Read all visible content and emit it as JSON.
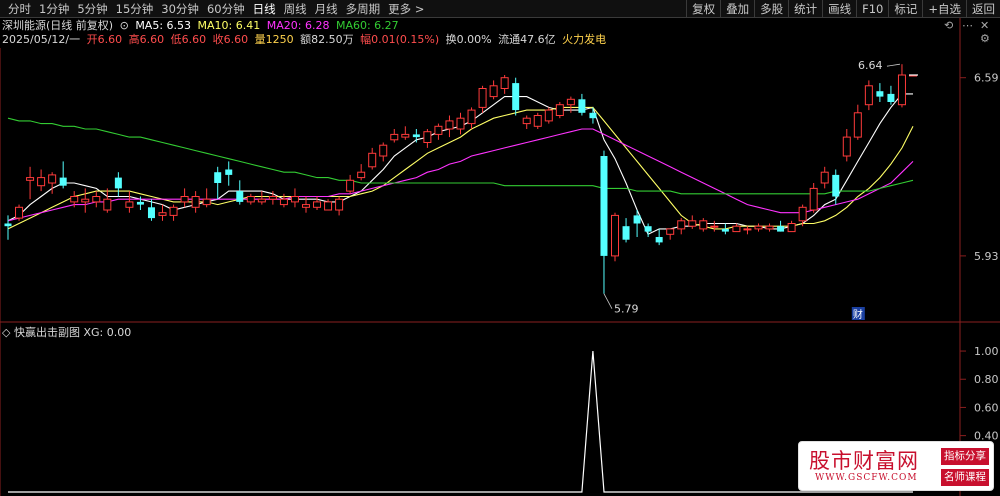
{
  "toolbar": {
    "periods": [
      "分时",
      "1分钟",
      "5分钟",
      "15分钟",
      "30分钟",
      "60分钟",
      "日线",
      "周线",
      "月线",
      "多周期",
      "更多 >"
    ],
    "active_period": "日线",
    "actions": [
      "复权",
      "叠加",
      "多股",
      "统计",
      "画线",
      "F10",
      "标记",
      "+自选",
      "返回"
    ]
  },
  "info": {
    "stock": "深圳能源(日线 前复权)",
    "ma5": "MA5: 6.53",
    "ma10": "MA10: 6.41",
    "ma20": "MA20: 6.28",
    "ma60": "MA60: 6.27",
    "date": "2025/05/12/一",
    "open": "开6.60",
    "high": "高6.60",
    "low": "低6.60",
    "close": "收6.60",
    "volume": "量1250",
    "amount": "额82.50万",
    "change": "幅0.01(0.15%)",
    "turnover": "换0.00%",
    "float": "流通47.6亿",
    "concept": "火力发电"
  },
  "sub_chart": {
    "title": "快赢出击副图",
    "xg": "XG: 0.00"
  },
  "watermark": {
    "main": "股市财富网",
    "sub": "WWW.GSCFW.COM",
    "tag1": "指标分享",
    "tag2": "名师课程"
  },
  "colors": {
    "up": "#ff3b3b",
    "down": "#54ffff",
    "ma5": "#ffffff",
    "ma10": "#ffff66",
    "ma20": "#ff33ff",
    "ma60": "#33cc33"
  },
  "chart_data": [
    {
      "type": "candlestick",
      "ylim": [
        5.7,
        6.7
      ],
      "y_ticks": [
        "6.59",
        "5.93"
      ],
      "annotations": {
        "max_label": "6.64",
        "min_label": "5.79",
        "finance_marker": "财"
      },
      "candles": [
        [
          6.05,
          6.08,
          5.99,
          6.04
        ],
        [
          6.07,
          6.12,
          6.06,
          6.11
        ],
        [
          6.21,
          6.26,
          6.14,
          6.22
        ],
        [
          6.19,
          6.25,
          6.17,
          6.22
        ],
        [
          6.2,
          6.24,
          6.16,
          6.23
        ],
        [
          6.22,
          6.28,
          6.18,
          6.19
        ],
        [
          6.13,
          6.17,
          6.11,
          6.15
        ],
        [
          6.13,
          6.18,
          6.09,
          6.14
        ],
        [
          6.13,
          6.17,
          6.11,
          6.15
        ],
        [
          6.1,
          6.18,
          6.09,
          6.14
        ],
        [
          6.22,
          6.24,
          6.15,
          6.18
        ],
        [
          6.11,
          6.17,
          6.09,
          6.13
        ],
        [
          6.13,
          6.15,
          6.1,
          6.12
        ],
        [
          6.11,
          6.14,
          6.06,
          6.07
        ],
        [
          6.08,
          6.12,
          6.06,
          6.09
        ],
        [
          6.08,
          6.12,
          6.06,
          6.11
        ],
        [
          6.13,
          6.18,
          6.11,
          6.15
        ],
        [
          6.11,
          6.17,
          6.09,
          6.15
        ],
        [
          6.12,
          6.18,
          6.11,
          6.14
        ],
        [
          6.24,
          6.26,
          6.14,
          6.2
        ],
        [
          6.25,
          6.28,
          6.19,
          6.23
        ],
        [
          6.17,
          6.21,
          6.12,
          6.13
        ],
        [
          6.13,
          6.16,
          6.12,
          6.15
        ],
        [
          6.13,
          6.17,
          6.12,
          6.14
        ],
        [
          6.14,
          6.17,
          6.12,
          6.15
        ],
        [
          6.12,
          6.16,
          6.11,
          6.14
        ],
        [
          6.13,
          6.18,
          6.11,
          6.15
        ],
        [
          6.11,
          6.15,
          6.09,
          6.12
        ],
        [
          6.11,
          6.15,
          6.1,
          6.13
        ],
        [
          6.1,
          6.14,
          6.1,
          6.13
        ],
        [
          6.1,
          6.15,
          6.08,
          6.14
        ],
        [
          6.17,
          6.23,
          6.16,
          6.21
        ],
        [
          6.22,
          6.27,
          6.21,
          6.24
        ],
        [
          6.26,
          6.33,
          6.25,
          6.31
        ],
        [
          6.3,
          6.35,
          6.28,
          6.34
        ],
        [
          6.36,
          6.4,
          6.35,
          6.38
        ],
        [
          6.37,
          6.41,
          6.36,
          6.38
        ],
        [
          6.38,
          6.4,
          6.35,
          6.37
        ],
        [
          6.35,
          6.4,
          6.33,
          6.39
        ],
        [
          6.38,
          6.42,
          6.36,
          6.41
        ],
        [
          6.4,
          6.45,
          6.37,
          6.43
        ],
        [
          6.4,
          6.46,
          6.38,
          6.44
        ],
        [
          6.42,
          6.48,
          6.4,
          6.47
        ],
        [
          6.48,
          6.56,
          6.46,
          6.55
        ],
        [
          6.52,
          6.58,
          6.51,
          6.56
        ],
        [
          6.55,
          6.6,
          6.53,
          6.59
        ],
        [
          6.57,
          6.59,
          6.45,
          6.47
        ],
        [
          6.42,
          6.45,
          6.4,
          6.44
        ],
        [
          6.41,
          6.46,
          6.4,
          6.45
        ],
        [
          6.43,
          6.48,
          6.42,
          6.47
        ],
        [
          6.45,
          6.5,
          6.44,
          6.49
        ],
        [
          6.49,
          6.52,
          6.46,
          6.51
        ],
        [
          6.51,
          6.53,
          6.45,
          6.46
        ],
        [
          6.46,
          6.48,
          6.42,
          6.44
        ],
        [
          6.3,
          6.32,
          5.79,
          5.93
        ],
        [
          5.93,
          6.09,
          5.91,
          6.08
        ],
        [
          6.04,
          6.07,
          5.98,
          5.99
        ],
        [
          6.08,
          6.1,
          6.0,
          6.05
        ],
        [
          6.04,
          6.05,
          6.0,
          6.02
        ],
        [
          6.0,
          6.03,
          5.97,
          5.98
        ],
        [
          6.01,
          6.03,
          5.99,
          6.03
        ],
        [
          6.03,
          6.07,
          6.01,
          6.06
        ],
        [
          6.04,
          6.08,
          6.03,
          6.06
        ],
        [
          6.03,
          6.07,
          6.02,
          6.06
        ],
        [
          6.04,
          6.06,
          6.02,
          6.04
        ],
        [
          6.03,
          6.05,
          6.01,
          6.02
        ],
        [
          6.02,
          6.05,
          6.02,
          6.04
        ],
        [
          6.03,
          6.04,
          6.01,
          6.03
        ],
        [
          6.03,
          6.05,
          6.02,
          6.04
        ],
        [
          6.03,
          6.05,
          6.02,
          6.04
        ],
        [
          6.04,
          6.06,
          6.02,
          6.02
        ],
        [
          6.02,
          6.06,
          6.02,
          6.05
        ],
        [
          6.06,
          6.12,
          6.04,
          6.11
        ],
        [
          6.1,
          6.2,
          6.09,
          6.18
        ],
        [
          6.2,
          6.26,
          6.18,
          6.24
        ],
        [
          6.23,
          6.25,
          6.12,
          6.15
        ],
        [
          6.3,
          6.4,
          6.28,
          6.37
        ],
        [
          6.37,
          6.49,
          6.36,
          6.46
        ],
        [
          6.49,
          6.58,
          6.47,
          6.56
        ],
        [
          6.54,
          6.57,
          6.5,
          6.52
        ],
        [
          6.53,
          6.56,
          6.49,
          6.5
        ],
        [
          6.49,
          6.64,
          6.48,
          6.6
        ],
        [
          6.6,
          6.6,
          6.6,
          6.6
        ]
      ],
      "series": [
        {
          "name": "MA5",
          "values": [
            6.06,
            6.08,
            6.12,
            6.15,
            6.18,
            6.2,
            6.2,
            6.19,
            6.18,
            6.15,
            6.15,
            6.15,
            6.14,
            6.13,
            6.12,
            6.1,
            6.11,
            6.12,
            6.13,
            6.14,
            6.17,
            6.17,
            6.17,
            6.17,
            6.16,
            6.14,
            6.14,
            6.14,
            6.14,
            6.13,
            6.13,
            6.15,
            6.17,
            6.21,
            6.25,
            6.3,
            6.33,
            6.36,
            6.37,
            6.39,
            6.4,
            6.41,
            6.43,
            6.46,
            6.49,
            6.52,
            6.52,
            6.52,
            6.5,
            6.48,
            6.47,
            6.47,
            6.47,
            6.48,
            6.36,
            6.29,
            6.2,
            6.1,
            6.01,
            6.03,
            6.03,
            6.04,
            6.04,
            6.05,
            6.05,
            6.05,
            6.05,
            6.04,
            6.04,
            6.03,
            6.03,
            6.04,
            6.05,
            6.08,
            6.12,
            6.14,
            6.21,
            6.28,
            6.35,
            6.42,
            6.48,
            6.53,
            6.53
          ]
        },
        {
          "name": "MA10",
          "values": [
            6.03,
            6.05,
            6.07,
            6.09,
            6.11,
            6.13,
            6.15,
            6.16,
            6.17,
            6.17,
            6.17,
            6.17,
            6.16,
            6.15,
            6.14,
            6.13,
            6.13,
            6.13,
            6.13,
            6.12,
            6.13,
            6.14,
            6.15,
            6.15,
            6.15,
            6.15,
            6.15,
            6.15,
            6.15,
            6.15,
            6.15,
            6.15,
            6.16,
            6.17,
            6.19,
            6.22,
            6.25,
            6.28,
            6.31,
            6.33,
            6.35,
            6.37,
            6.4,
            6.42,
            6.44,
            6.45,
            6.46,
            6.47,
            6.47,
            6.47,
            6.48,
            6.48,
            6.48,
            6.48,
            6.43,
            6.38,
            6.33,
            6.28,
            6.23,
            6.18,
            6.13,
            6.08,
            6.05,
            6.04,
            6.03,
            6.03,
            6.04,
            6.04,
            6.04,
            6.04,
            6.04,
            6.04,
            6.05,
            6.05,
            6.06,
            6.08,
            6.11,
            6.15,
            6.18,
            6.22,
            6.27,
            6.33,
            6.41
          ]
        },
        {
          "name": "MA20",
          "values": [
            6.06,
            6.07,
            6.08,
            6.09,
            6.1,
            6.11,
            6.12,
            6.12,
            6.13,
            6.13,
            6.14,
            6.14,
            6.14,
            6.14,
            6.14,
            6.14,
            6.14,
            6.14,
            6.14,
            6.14,
            6.14,
            6.14,
            6.14,
            6.14,
            6.14,
            6.14,
            6.15,
            6.15,
            6.15,
            6.15,
            6.16,
            6.16,
            6.17,
            6.18,
            6.19,
            6.2,
            6.21,
            6.22,
            6.24,
            6.25,
            6.27,
            6.28,
            6.3,
            6.31,
            6.32,
            6.33,
            6.34,
            6.35,
            6.36,
            6.37,
            6.38,
            6.39,
            6.4,
            6.4,
            6.38,
            6.36,
            6.34,
            6.32,
            6.3,
            6.28,
            6.26,
            6.24,
            6.22,
            6.2,
            6.18,
            6.16,
            6.14,
            6.12,
            6.11,
            6.1,
            6.09,
            6.09,
            6.09,
            6.1,
            6.11,
            6.12,
            6.13,
            6.14,
            6.16,
            6.18,
            6.2,
            6.24,
            6.28
          ]
        },
        {
          "name": "MA60",
          "values": [
            6.44,
            6.43,
            6.43,
            6.42,
            6.42,
            6.41,
            6.41,
            6.4,
            6.4,
            6.39,
            6.38,
            6.37,
            6.37,
            6.36,
            6.35,
            6.34,
            6.33,
            6.32,
            6.31,
            6.3,
            6.29,
            6.28,
            6.27,
            6.26,
            6.25,
            6.24,
            6.24,
            6.23,
            6.22,
            6.22,
            6.21,
            6.21,
            6.2,
            6.2,
            6.2,
            6.2,
            6.2,
            6.2,
            6.2,
            6.2,
            6.2,
            6.2,
            6.2,
            6.2,
            6.2,
            6.19,
            6.19,
            6.19,
            6.19,
            6.19,
            6.19,
            6.19,
            6.19,
            6.19,
            6.18,
            6.18,
            6.18,
            6.17,
            6.17,
            6.17,
            6.17,
            6.16,
            6.16,
            6.16,
            6.16,
            6.16,
            6.16,
            6.16,
            6.16,
            6.16,
            6.16,
            6.16,
            6.16,
            6.16,
            6.16,
            6.17,
            6.17,
            6.17,
            6.17,
            6.18,
            6.19,
            6.2,
            6.21
          ]
        }
      ]
    },
    {
      "type": "line",
      "name": "XG",
      "ylim": [
        0,
        1.05
      ],
      "y_ticks": [
        "1.00",
        "0.80",
        "0.60",
        "0.40"
      ],
      "spike_index": 54,
      "values_note": "",
      "series": [
        {
          "values": [
            0,
            0,
            0,
            0,
            0,
            0,
            0,
            0,
            0,
            0,
            0,
            0,
            0,
            0,
            0,
            0,
            0,
            0,
            0,
            0,
            0,
            0,
            0,
            0,
            0,
            0,
            0,
            0,
            0,
            0,
            0,
            0,
            0,
            0,
            0,
            0,
            0,
            0,
            0,
            0,
            0,
            0,
            0,
            0,
            0,
            0,
            0,
            0,
            0,
            0,
            0,
            0,
            0,
            1,
            0,
            0,
            0,
            0,
            0,
            0,
            0,
            0,
            0,
            0,
            0,
            0,
            0,
            0,
            0,
            0,
            0,
            0,
            0,
            0,
            0,
            0,
            0,
            0,
            0,
            0,
            0,
            0,
            0
          ]
        }
      ]
    }
  ]
}
